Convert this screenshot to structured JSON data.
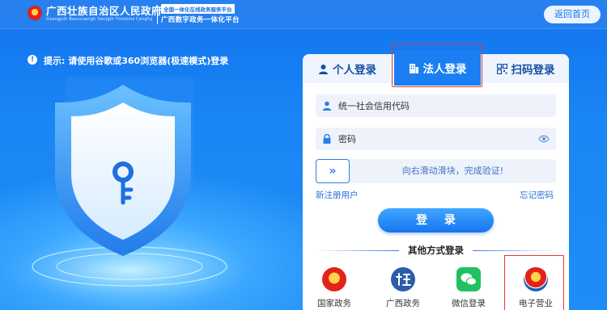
{
  "header": {
    "site_title": "广西壮族自治区人民政府",
    "site_subtitle": "Gvangjsih Bouxcuengh Swcigih Yinzminz Cengfuj",
    "platform_tag": "全国一体化在线政务服务平台",
    "platform_name": "广西数字政务一体化平台",
    "home_button": "返回首页"
  },
  "tip": {
    "icon": "!",
    "text": "提示: 请使用谷歌或360浏览器(极速模式)登录"
  },
  "tabs": [
    {
      "label": "个人登录",
      "icon": "person-icon",
      "active": false
    },
    {
      "label": "法人登录",
      "icon": "building-icon",
      "active": true
    },
    {
      "label": "扫码登录",
      "icon": "qr-icon",
      "active": false
    }
  ],
  "form": {
    "credit_code_placeholder": "统一社会信用代码",
    "password_placeholder": "密码",
    "slider_handle": "»",
    "slider_text": "向右滑动滑块，完成验证!",
    "register_link": "新注册用户",
    "forgot_link": "忘记密码",
    "login_button": "登 录"
  },
  "other_login": {
    "title": "其他方式登录",
    "methods": [
      {
        "label": "国家政务",
        "icon": "national-emblem-icon"
      },
      {
        "label": "广西政务",
        "icon": "guangxi-gov-icon"
      },
      {
        "label": "微信登录",
        "icon": "wechat-icon"
      },
      {
        "label": "电子营业",
        "icon": "e-business-license-icon"
      }
    ]
  },
  "colors": {
    "brand_blue": "#1b7ff3",
    "highlight_red": "#e53935"
  }
}
